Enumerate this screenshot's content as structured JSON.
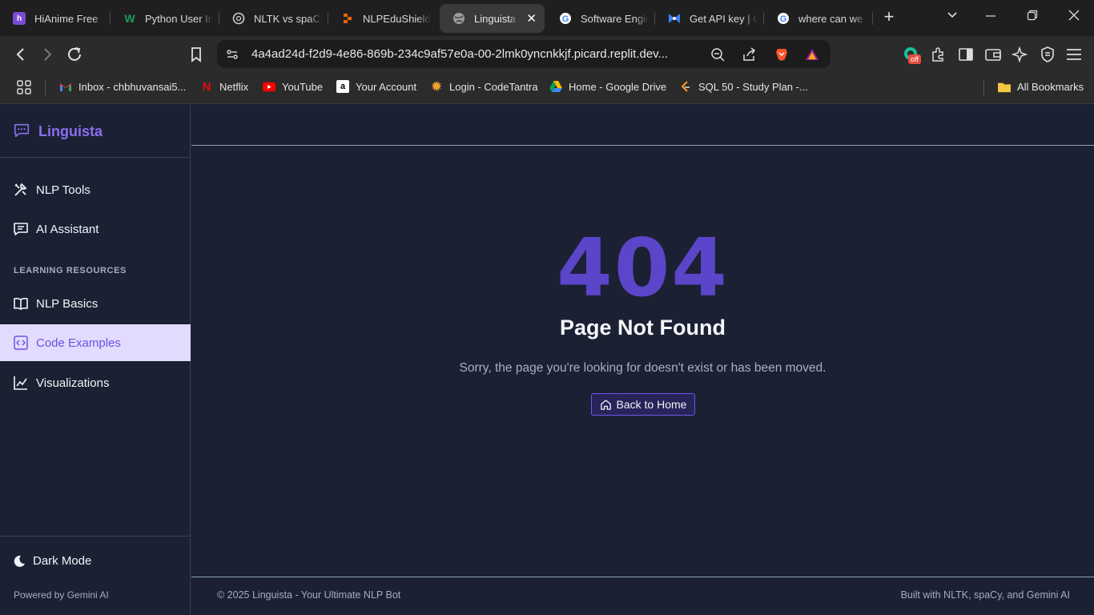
{
  "browser": {
    "tabs": [
      {
        "title": "HiAnime Free",
        "icon": "hianime-icon",
        "color": "#7b4bd6"
      },
      {
        "title": "Python User In",
        "icon": "w-icon",
        "color": "#1a9c5b"
      },
      {
        "title": "NLTK vs spaCy",
        "icon": "chatgpt-icon",
        "color": "#cfcfcf"
      },
      {
        "title": "NLPEduShield",
        "icon": "replit-icon",
        "color": "#f26207"
      },
      {
        "title": "Linguista",
        "icon": "globe-icon",
        "color": "#9a9a9a"
      },
      {
        "title": "Software Engin",
        "icon": "google-icon",
        "color": "#4285f4"
      },
      {
        "title": "Get API key | G",
        "icon": "ai-studio-icon",
        "color": "#3b82f6"
      },
      {
        "title": "where can we",
        "icon": "google-icon",
        "color": "#4285f4"
      }
    ],
    "url": "4a4ad24d-f2d9-4e86-869b-234c9af57e0a-00-2lmk0yncnkkjf.picard.replit.dev...",
    "extension_badge": "off",
    "bookmarks": [
      {
        "label": "Inbox - chbhuvansai5...",
        "icon": "gmail-icon"
      },
      {
        "label": "Netflix",
        "icon": "netflix-icon"
      },
      {
        "label": "YouTube",
        "icon": "youtube-icon"
      },
      {
        "label": "Your Account",
        "icon": "amazon-icon"
      },
      {
        "label": "Login - CodeTantra",
        "icon": "codetantra-icon"
      },
      {
        "label": "Home - Google Drive",
        "icon": "drive-icon"
      },
      {
        "label": "SQL 50 - Study Plan -...",
        "icon": "leetcode-icon"
      }
    ],
    "all_bookmarks": "All Bookmarks"
  },
  "app": {
    "name": "Linguista",
    "nav": {
      "nlp_tools": "NLP Tools",
      "ai_assistant": "AI Assistant",
      "section": "LEARNING RESOURCES",
      "nlp_basics": "NLP Basics",
      "code_examples": "Code Examples",
      "visualizations": "Visualizations"
    },
    "dark_mode": "Dark Mode",
    "powered_by": "Powered by Gemini AI",
    "error": {
      "code": "404",
      "title": "Page Not Found",
      "message": "Sorry, the page you're looking for doesn't exist or has been moved.",
      "button": "Back to Home"
    },
    "footer": {
      "left": "© 2025 Linguista - Your Ultimate NLP Bot",
      "right": "Built with NLTK, spaCy, and Gemini AI"
    }
  },
  "colors": {
    "accent": "#5b45c9",
    "sidebar_active_bg": "#e2dbfe",
    "background": "#1b2133"
  }
}
